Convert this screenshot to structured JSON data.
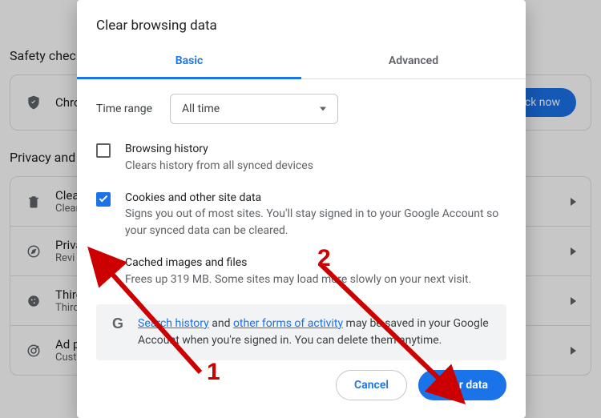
{
  "background": {
    "safety_heading": "Safety check",
    "safety_row_text": "Chro",
    "check_now": "eck now",
    "privacy_heading": "Privacy and s",
    "rows": [
      {
        "title": "Clear",
        "sub": "Clear"
      },
      {
        "title": "Priva",
        "sub": "Revi"
      },
      {
        "title": "Third",
        "sub": "Third"
      },
      {
        "title": "Ad p",
        "sub": "Cust"
      }
    ]
  },
  "modal": {
    "title": "Clear browsing data",
    "tabs": {
      "basic": "Basic",
      "advanced": "Advanced"
    },
    "time_range_label": "Time range",
    "time_range_value": "All time",
    "options": [
      {
        "checked": false,
        "title": "Browsing history",
        "desc": "Clears history from all synced devices"
      },
      {
        "checked": true,
        "title": "Cookies and other site data",
        "desc": "Signs you out of most sites. You'll stay signed in to your Google Account so your synced data can be cleared."
      },
      {
        "checked": true,
        "title": "Cached images and files",
        "desc": "Frees up 319 MB. Some sites may load more slowly on your next visit."
      }
    ],
    "info": {
      "prefix": "",
      "link1": "Search history",
      "mid": " and ",
      "link2": "other forms of activity",
      "suffix": " may be saved in your Google Account when you're signed in. You can delete them anytime."
    },
    "buttons": {
      "cancel": "Cancel",
      "clear": "Clear data"
    }
  },
  "annotations": {
    "one": "1",
    "two": "2"
  }
}
